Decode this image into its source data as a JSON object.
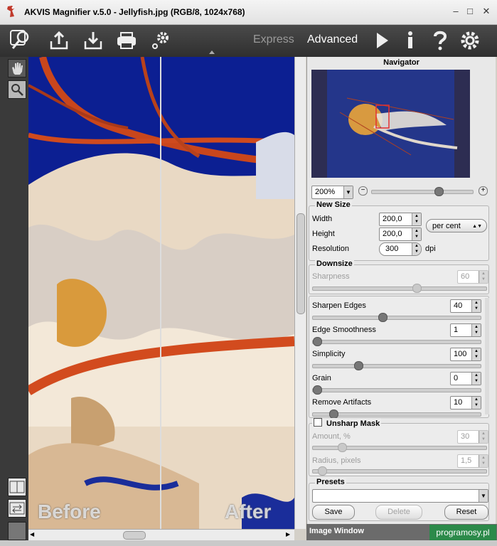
{
  "window": {
    "title": "AKVIS Magnifier v.5.0 - Jellyfish.jpg (RGB/8, 1024x768)",
    "minimize": "–",
    "maximize": "□",
    "close": "✕"
  },
  "toolbar": {
    "mode_express": "Express",
    "mode_advanced": "Advanced"
  },
  "canvas": {
    "before_label": "Before",
    "after_label": "After"
  },
  "navigator": {
    "title": "Navigator",
    "zoom": "200%"
  },
  "new_size": {
    "title": "New Size",
    "width_label": "Width",
    "width_value": "200,0",
    "height_label": "Height",
    "height_value": "200,0",
    "unit": "per cent",
    "resolution_label": "Resolution",
    "resolution_value": "300",
    "resolution_unit": "dpi"
  },
  "downsize": {
    "title": "Downsize",
    "sharpness_label": "Sharpness",
    "sharpness_value": "60",
    "sharpness_level": 0.6
  },
  "params": [
    {
      "label": "Sharpen Edges",
      "value": "40",
      "level": 0.4
    },
    {
      "label": "Edge Smoothness",
      "value": "1",
      "level": 0.0
    },
    {
      "label": "Simplicity",
      "value": "100",
      "level": 0.25
    },
    {
      "label": "Grain",
      "value": "0",
      "level": 0.0
    },
    {
      "label": "Remove Artifacts",
      "value": "10",
      "level": 0.1
    }
  ],
  "unsharp": {
    "title": "Unsharp Mask",
    "amount_label": "Amount, %",
    "amount_value": "30",
    "amount_level": 0.15,
    "radius_label": "Radius, pixels",
    "radius_value": "1,5",
    "radius_level": 0.03
  },
  "presets": {
    "title": "Presets",
    "save": "Save",
    "delete": "Delete",
    "reset": "Reset"
  },
  "footer": {
    "image_window": "Image Window",
    "watermark": "programosy.pl"
  }
}
